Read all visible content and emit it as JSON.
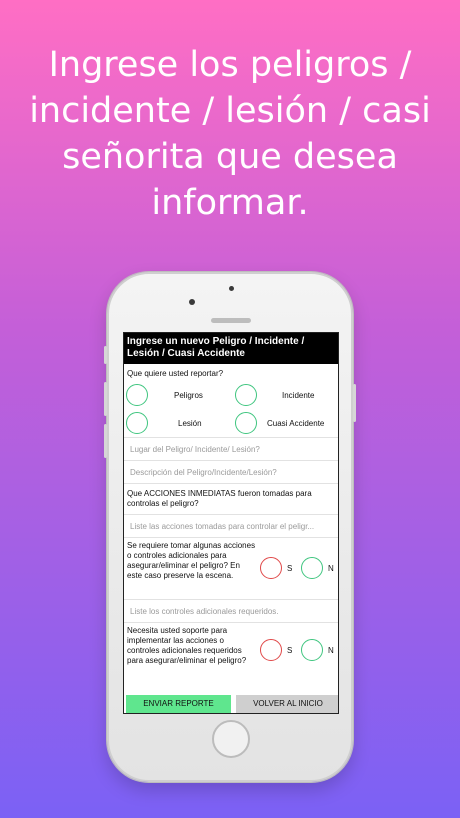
{
  "headline": "Ingrese los peligros / incidente / lesión / casi señorita que desea informar.",
  "form": {
    "title": "Ingrese un nuevo Peligro / Incidente / Lesión / Cuasi Accidente",
    "report_question": "Que quiere usted reportar?",
    "options": [
      "Peligros",
      "Incidente",
      "Lesión",
      "Cuasi Accidente"
    ],
    "place_placeholder": "Lugar del Peligro/ Incidente/ Lesión?",
    "description_placeholder": "Descripción del Peligro/Incidente/Lesión?",
    "actions_question": "Que ACCIONES INMEDIATAS fueron tomadas para controlas el peligro?",
    "actions_placeholder": "Liste las acciones tomadas para controlar el peligr...",
    "controls_question": "Se requiere tomar algunas acciones o controles adicionales para asegurar/eliminar el peligro? En este caso preserve la escena.",
    "controls_placeholder": "Liste los controles adicionales requeridos.",
    "support_question": "Necesita usted soporte para implementar las acciones o controles adicionales requeridos para asegurar/eliminar el peligro?",
    "yes_label": "S",
    "no_label": "N",
    "send_button": "ENVIAR REPORTE",
    "back_button": "VOLVER AL INICIO"
  },
  "colors": {
    "green": "#3fc57f",
    "red": "#e04848",
    "send_button_bg": "#5fe68e",
    "back_button_bg": "#cfcfcf"
  }
}
